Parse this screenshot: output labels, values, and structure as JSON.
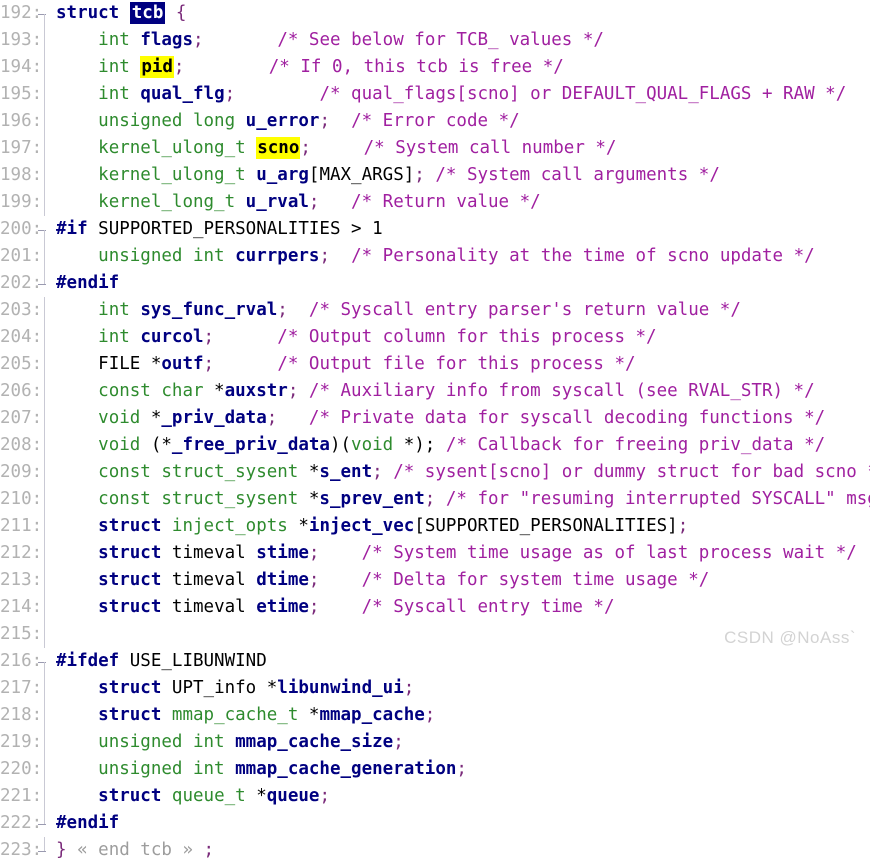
{
  "editor": {
    "language": "C",
    "first_line": 192,
    "last_line": 223,
    "colors": {
      "background": "#ffffff",
      "line_number": "#b2b2b2",
      "keyword": "#000080",
      "type": "#2e8b2e",
      "identifier": "#000080",
      "comment": "#a020a0",
      "macro": "#e8160f",
      "punctuation": "#7a2a7a",
      "selection_bg": "#000080",
      "selection_fg": "#ffffff",
      "occurrence_highlight_bg": "#ffff00",
      "fold_marker": "#9d9d9d",
      "watermark": "#d3d3d3"
    }
  },
  "watermark": "CSDN @NoAss`",
  "lines": [
    {
      "n": "192",
      "fold": "start",
      "text": "struct tcb {"
    },
    {
      "n": "193",
      "fold": "inside",
      "text": "    int flags;       /* See below for TCB_ values */"
    },
    {
      "n": "194",
      "fold": "inside",
      "text": "    int pid;         /* If 0, this tcb is free */"
    },
    {
      "n": "195",
      "fold": "inside",
      "text": "    int qual_flg;        /* qual_flags[scno] or DEFAULT_QUAL_FLAGS + RAW */"
    },
    {
      "n": "196",
      "fold": "inside",
      "text": "    unsigned long u_error;  /* Error code */"
    },
    {
      "n": "197",
      "fold": "inside",
      "text": "    kernel_ulong_t scno;     /* System call number */"
    },
    {
      "n": "198",
      "fold": "inside",
      "text": "    kernel_ulong_t u_arg[MAX_ARGS]; /* System call arguments */"
    },
    {
      "n": "199",
      "fold": "inside",
      "text": "    kernel_long_t u_rval;    /* Return value */"
    },
    {
      "n": "200",
      "fold": "start",
      "text": "#if SUPPORTED_PERSONALITIES > 1"
    },
    {
      "n": "201",
      "fold": "inside",
      "text": "    unsigned int currpers;  /* Personality at the time of scno update */"
    },
    {
      "n": "202",
      "fold": "end",
      "text": "#endif"
    },
    {
      "n": "203",
      "fold": "inside",
      "text": "    int sys_func_rval;  /* Syscall entry parser's return value */"
    },
    {
      "n": "204",
      "fold": "inside",
      "text": "    int curcol;      /* Output column for this process */"
    },
    {
      "n": "205",
      "fold": "inside",
      "text": "    FILE *outf;      /* Output file for this process */"
    },
    {
      "n": "206",
      "fold": "inside",
      "text": "    const char *auxstr; /* Auxiliary info from syscall (see RVAL_STR) */"
    },
    {
      "n": "207",
      "fold": "inside",
      "text": "    void *_priv_data;   /* Private data for syscall decoding functions */"
    },
    {
      "n": "208",
      "fold": "inside",
      "text": "    void (*_free_priv_data)(void *); /* Callback for freeing priv_data */"
    },
    {
      "n": "209",
      "fold": "inside",
      "text": "    const struct_sysent *s_ent; /* sysent[scno] or dummy struct for bad scno */"
    },
    {
      "n": "210",
      "fold": "inside",
      "text": "    const struct_sysent *s_prev_ent; /* for \"resuming interrupted SYSCALL\" msg */"
    },
    {
      "n": "211",
      "fold": "inside",
      "text": "    struct inject_opts *inject_vec[SUPPORTED_PERSONALITIES];"
    },
    {
      "n": "212",
      "fold": "inside",
      "text": "    struct timeval stime;    /* System time usage as of last process wait */"
    },
    {
      "n": "213",
      "fold": "inside",
      "text": "    struct timeval dtime;    /* Delta for system time usage */"
    },
    {
      "n": "214",
      "fold": "inside",
      "text": "    struct timeval etime;    /* Syscall entry time */"
    },
    {
      "n": "215",
      "fold": "inside",
      "text": ""
    },
    {
      "n": "216",
      "fold": "start",
      "text": "#ifdef USE_LIBUNWIND"
    },
    {
      "n": "217",
      "fold": "inside",
      "text": "    struct UPT_info *libunwind_ui;"
    },
    {
      "n": "218",
      "fold": "inside",
      "text": "    struct mmap_cache_t *mmap_cache;"
    },
    {
      "n": "219",
      "fold": "inside",
      "text": "    unsigned int mmap_cache_size;"
    },
    {
      "n": "220",
      "fold": "inside",
      "text": "    unsigned int mmap_cache_generation;"
    },
    {
      "n": "221",
      "fold": "inside",
      "text": "    struct queue_t *queue;"
    },
    {
      "n": "222",
      "fold": "end",
      "text": "#endif"
    },
    {
      "n": "223",
      "fold": "end",
      "text": "} « end tcb » ;"
    }
  ],
  "tokens": [
    [
      {
        "t": "struct",
        "c": "kw"
      },
      {
        "t": " ",
        "c": "plain"
      },
      {
        "t": "tcb",
        "c": "hl-sel"
      },
      {
        "t": " ",
        "c": "plain"
      },
      {
        "t": "{",
        "c": "punc"
      }
    ],
    [
      {
        "t": "    ",
        "c": "plain"
      },
      {
        "t": "int",
        "c": "type"
      },
      {
        "t": " ",
        "c": "plain"
      },
      {
        "t": "flags",
        "c": "ident"
      },
      {
        "t": ";",
        "c": "punc"
      },
      {
        "t": "       ",
        "c": "plain"
      },
      {
        "t": "/* See below for TCB_ values */",
        "c": "cmt"
      }
    ],
    [
      {
        "t": "    ",
        "c": "plain"
      },
      {
        "t": "int",
        "c": "type"
      },
      {
        "t": " ",
        "c": "plain"
      },
      {
        "t": "pid",
        "c": "hl-yel"
      },
      {
        "t": ";",
        "c": "punc"
      },
      {
        "t": "        ",
        "c": "plain"
      },
      {
        "t": "/* If 0, this tcb is free */",
        "c": "cmt"
      }
    ],
    [
      {
        "t": "    ",
        "c": "plain"
      },
      {
        "t": "int",
        "c": "type"
      },
      {
        "t": " ",
        "c": "plain"
      },
      {
        "t": "qual_flg",
        "c": "ident"
      },
      {
        "t": ";",
        "c": "punc"
      },
      {
        "t": "        ",
        "c": "plain"
      },
      {
        "t": "/* qual_flags[scno] or DEFAULT_QUAL_FLAGS + RAW */",
        "c": "cmt"
      }
    ],
    [
      {
        "t": "    ",
        "c": "plain"
      },
      {
        "t": "unsigned long",
        "c": "type"
      },
      {
        "t": " ",
        "c": "plain"
      },
      {
        "t": "u_error",
        "c": "ident"
      },
      {
        "t": ";",
        "c": "punc"
      },
      {
        "t": "  ",
        "c": "plain"
      },
      {
        "t": "/* Error code */",
        "c": "cmt"
      }
    ],
    [
      {
        "t": "    ",
        "c": "plain"
      },
      {
        "t": "kernel_ulong_t",
        "c": "type"
      },
      {
        "t": " ",
        "c": "plain"
      },
      {
        "t": "scno",
        "c": "hl-yel"
      },
      {
        "t": ";",
        "c": "punc"
      },
      {
        "t": "     ",
        "c": "plain"
      },
      {
        "t": "/* System call number */",
        "c": "cmt"
      }
    ],
    [
      {
        "t": "    ",
        "c": "plain"
      },
      {
        "t": "kernel_ulong_t",
        "c": "type"
      },
      {
        "t": " ",
        "c": "plain"
      },
      {
        "t": "u_arg",
        "c": "ident"
      },
      {
        "t": "[",
        "c": "plain"
      },
      {
        "t": "MAX_ARGS",
        "c": "macro"
      },
      {
        "t": "]",
        "c": "plain"
      },
      {
        "t": ";",
        "c": "punc"
      },
      {
        "t": " ",
        "c": "plain"
      },
      {
        "t": "/* System call arguments */",
        "c": "cmt"
      }
    ],
    [
      {
        "t": "    ",
        "c": "plain"
      },
      {
        "t": "kernel_long_t",
        "c": "type"
      },
      {
        "t": " ",
        "c": "plain"
      },
      {
        "t": "u_rval",
        "c": "ident"
      },
      {
        "t": ";",
        "c": "punc"
      },
      {
        "t": "   ",
        "c": "plain"
      },
      {
        "t": "/* Return value */",
        "c": "cmt"
      }
    ],
    [
      {
        "t": "#if",
        "c": "kw"
      },
      {
        "t": " ",
        "c": "plain"
      },
      {
        "t": "SUPPORTED_PERSONALITIES",
        "c": "macro"
      },
      {
        "t": " > 1",
        "c": "plain"
      }
    ],
    [
      {
        "t": "    ",
        "c": "plain"
      },
      {
        "t": "unsigned int",
        "c": "type"
      },
      {
        "t": " ",
        "c": "plain"
      },
      {
        "t": "currpers",
        "c": "ident"
      },
      {
        "t": ";",
        "c": "punc"
      },
      {
        "t": "  ",
        "c": "plain"
      },
      {
        "t": "/* Personality at the time of scno update */",
        "c": "cmt"
      }
    ],
    [
      {
        "t": "#endif",
        "c": "kw"
      }
    ],
    [
      {
        "t": "    ",
        "c": "plain"
      },
      {
        "t": "int",
        "c": "type"
      },
      {
        "t": " ",
        "c": "plain"
      },
      {
        "t": "sys_func_rval",
        "c": "ident"
      },
      {
        "t": ";",
        "c": "punc"
      },
      {
        "t": "  ",
        "c": "plain"
      },
      {
        "t": "/* Syscall entry parser's return value */",
        "c": "cmt"
      }
    ],
    [
      {
        "t": "    ",
        "c": "plain"
      },
      {
        "t": "int",
        "c": "type"
      },
      {
        "t": " ",
        "c": "plain"
      },
      {
        "t": "curcol",
        "c": "ident"
      },
      {
        "t": ";",
        "c": "punc"
      },
      {
        "t": "      ",
        "c": "plain"
      },
      {
        "t": "/* Output column for this process */",
        "c": "cmt"
      }
    ],
    [
      {
        "t": "    ",
        "c": "plain"
      },
      {
        "t": "FILE",
        "c": "plain"
      },
      {
        "t": " *",
        "c": "plain"
      },
      {
        "t": "outf",
        "c": "ident"
      },
      {
        "t": ";",
        "c": "punc"
      },
      {
        "t": "      ",
        "c": "plain"
      },
      {
        "t": "/* Output file for this process */",
        "c": "cmt"
      }
    ],
    [
      {
        "t": "    ",
        "c": "plain"
      },
      {
        "t": "const char",
        "c": "type"
      },
      {
        "t": " *",
        "c": "plain"
      },
      {
        "t": "auxstr",
        "c": "ident"
      },
      {
        "t": ";",
        "c": "punc"
      },
      {
        "t": " ",
        "c": "plain"
      },
      {
        "t": "/* Auxiliary info from syscall (see RVAL_STR) */",
        "c": "cmt"
      }
    ],
    [
      {
        "t": "    ",
        "c": "plain"
      },
      {
        "t": "void",
        "c": "type"
      },
      {
        "t": " *",
        "c": "plain"
      },
      {
        "t": "_priv_data",
        "c": "ident"
      },
      {
        "t": ";",
        "c": "punc"
      },
      {
        "t": "   ",
        "c": "plain"
      },
      {
        "t": "/* Private data for syscall decoding functions */",
        "c": "cmt"
      }
    ],
    [
      {
        "t": "    ",
        "c": "plain"
      },
      {
        "t": "void",
        "c": "type"
      },
      {
        "t": " (*",
        "c": "plain"
      },
      {
        "t": "_free_priv_data",
        "c": "ident"
      },
      {
        "t": ")(",
        "c": "plain"
      },
      {
        "t": "void",
        "c": "type"
      },
      {
        "t": " *);",
        "c": "plain"
      },
      {
        "t": " ",
        "c": "plain"
      },
      {
        "t": "/* Callback for freeing priv_data */",
        "c": "cmt"
      }
    ],
    [
      {
        "t": "    ",
        "c": "plain"
      },
      {
        "t": "const struct_sysent",
        "c": "type"
      },
      {
        "t": " *",
        "c": "plain"
      },
      {
        "t": "s_ent",
        "c": "ident"
      },
      {
        "t": ";",
        "c": "punc"
      },
      {
        "t": " ",
        "c": "plain"
      },
      {
        "t": "/* sysent[scno] or dummy struct for bad scno */",
        "c": "cmt"
      }
    ],
    [
      {
        "t": "    ",
        "c": "plain"
      },
      {
        "t": "const struct_sysent",
        "c": "type"
      },
      {
        "t": " *",
        "c": "plain"
      },
      {
        "t": "s_prev_ent",
        "c": "ident"
      },
      {
        "t": ";",
        "c": "punc"
      },
      {
        "t": " ",
        "c": "plain"
      },
      {
        "t": "/* for \"resuming interrupted SYSCALL\" msg */",
        "c": "cmt"
      }
    ],
    [
      {
        "t": "    ",
        "c": "plain"
      },
      {
        "t": "struct",
        "c": "kw"
      },
      {
        "t": " ",
        "c": "plain"
      },
      {
        "t": "inject_opts",
        "c": "type"
      },
      {
        "t": " *",
        "c": "plain"
      },
      {
        "t": "inject_vec",
        "c": "ident"
      },
      {
        "t": "[",
        "c": "plain"
      },
      {
        "t": "SUPPORTED_PERSONALITIES",
        "c": "macro"
      },
      {
        "t": "]",
        "c": "plain"
      },
      {
        "t": ";",
        "c": "punc"
      }
    ],
    [
      {
        "t": "    ",
        "c": "plain"
      },
      {
        "t": "struct",
        "c": "kw"
      },
      {
        "t": " ",
        "c": "plain"
      },
      {
        "t": "timeval",
        "c": "plain"
      },
      {
        "t": " ",
        "c": "plain"
      },
      {
        "t": "stime",
        "c": "ident"
      },
      {
        "t": ";",
        "c": "punc"
      },
      {
        "t": "    ",
        "c": "plain"
      },
      {
        "t": "/* System time usage as of last process wait */",
        "c": "cmt"
      }
    ],
    [
      {
        "t": "    ",
        "c": "plain"
      },
      {
        "t": "struct",
        "c": "kw"
      },
      {
        "t": " ",
        "c": "plain"
      },
      {
        "t": "timeval",
        "c": "plain"
      },
      {
        "t": " ",
        "c": "plain"
      },
      {
        "t": "dtime",
        "c": "ident"
      },
      {
        "t": ";",
        "c": "punc"
      },
      {
        "t": "    ",
        "c": "plain"
      },
      {
        "t": "/* Delta for system time usage */",
        "c": "cmt"
      }
    ],
    [
      {
        "t": "    ",
        "c": "plain"
      },
      {
        "t": "struct",
        "c": "kw"
      },
      {
        "t": " ",
        "c": "plain"
      },
      {
        "t": "timeval",
        "c": "plain"
      },
      {
        "t": " ",
        "c": "plain"
      },
      {
        "t": "etime",
        "c": "ident"
      },
      {
        "t": ";",
        "c": "punc"
      },
      {
        "t": "    ",
        "c": "plain"
      },
      {
        "t": "/* Syscall entry time */",
        "c": "cmt"
      }
    ],
    [
      {
        "t": "",
        "c": "plain"
      }
    ],
    [
      {
        "t": "#ifdef",
        "c": "kw"
      },
      {
        "t": " ",
        "c": "plain"
      },
      {
        "t": "USE_LIBUNWIND",
        "c": "plain"
      }
    ],
    [
      {
        "t": "    ",
        "c": "plain"
      },
      {
        "t": "struct",
        "c": "kw"
      },
      {
        "t": " ",
        "c": "plain"
      },
      {
        "t": "UPT_info",
        "c": "plain"
      },
      {
        "t": " *",
        "c": "plain"
      },
      {
        "t": "libunwind_ui",
        "c": "ident"
      },
      {
        "t": ";",
        "c": "punc"
      }
    ],
    [
      {
        "t": "    ",
        "c": "plain"
      },
      {
        "t": "struct",
        "c": "kw"
      },
      {
        "t": " ",
        "c": "plain"
      },
      {
        "t": "mmap_cache_t",
        "c": "type"
      },
      {
        "t": " *",
        "c": "plain"
      },
      {
        "t": "mmap_cache",
        "c": "ident"
      },
      {
        "t": ";",
        "c": "punc"
      }
    ],
    [
      {
        "t": "    ",
        "c": "plain"
      },
      {
        "t": "unsigned int",
        "c": "type"
      },
      {
        "t": " ",
        "c": "plain"
      },
      {
        "t": "mmap_cache_size",
        "c": "ident"
      },
      {
        "t": ";",
        "c": "punc"
      }
    ],
    [
      {
        "t": "    ",
        "c": "plain"
      },
      {
        "t": "unsigned int",
        "c": "type"
      },
      {
        "t": " ",
        "c": "plain"
      },
      {
        "t": "mmap_cache_generation",
        "c": "ident"
      },
      {
        "t": ";",
        "c": "punc"
      }
    ],
    [
      {
        "t": "    ",
        "c": "plain"
      },
      {
        "t": "struct",
        "c": "kw"
      },
      {
        "t": " ",
        "c": "plain"
      },
      {
        "t": "queue_t",
        "c": "type"
      },
      {
        "t": " *",
        "c": "plain"
      },
      {
        "t": "queue",
        "c": "ident"
      },
      {
        "t": ";",
        "c": "punc"
      }
    ],
    [
      {
        "t": "#endif",
        "c": "kw"
      }
    ],
    [
      {
        "t": "}",
        "c": "punc"
      },
      {
        "t": " ",
        "c": "plain"
      },
      {
        "t": "« end tcb »",
        "c": "fold"
      },
      {
        "t": " ",
        "c": "plain"
      },
      {
        "t": ";",
        "c": "punc"
      }
    ]
  ]
}
